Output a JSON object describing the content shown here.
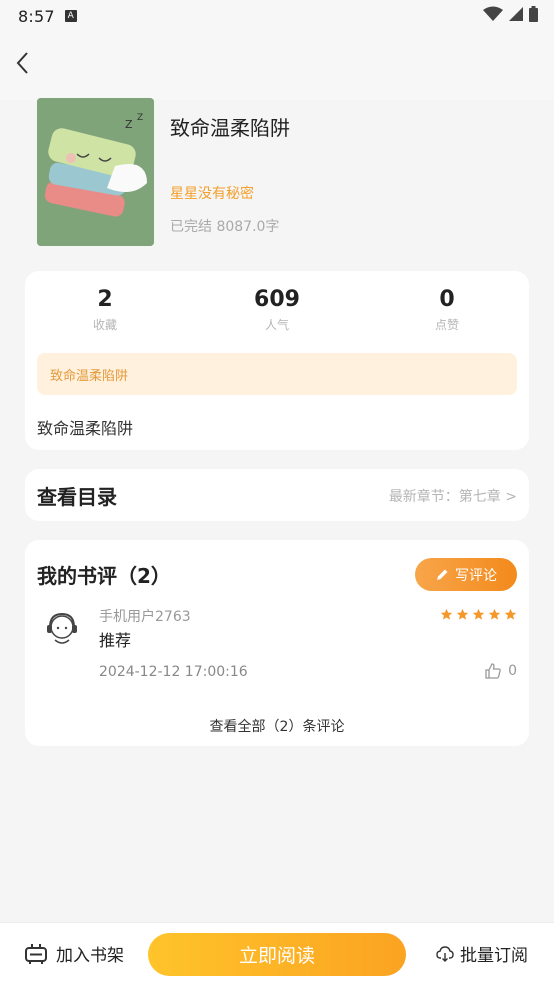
{
  "status_bar": {
    "time": "8:57",
    "a_icon": "A"
  },
  "book": {
    "title": "致命温柔陷阱",
    "author": "星星没有秘密",
    "meta": "已完结 8087.0字"
  },
  "stats": [
    {
      "value": "2",
      "label": "收藏"
    },
    {
      "value": "609",
      "label": "人气"
    },
    {
      "value": "0",
      "label": "点赞"
    }
  ],
  "tagline": "致命温柔陷阱",
  "intro": "致命温柔陷阱",
  "catalog": {
    "title": "查看目录",
    "latest": "最新章节：第七章 >"
  },
  "reviews": {
    "title": "我的书评（2）",
    "write_label": "写评论",
    "items": [
      {
        "user": "手机用户2763",
        "text": "推荐",
        "time": "2024-12-12 17:00:16",
        "likes": "0",
        "rating": 5
      }
    ],
    "view_all": "查看全部（2）条评论"
  },
  "bottom": {
    "add_shelf": "加入书架",
    "read_now": "立即阅读",
    "batch_subscribe": "批量订阅"
  },
  "colors": {
    "accent": "#f4a02a",
    "button": "#fba322"
  }
}
